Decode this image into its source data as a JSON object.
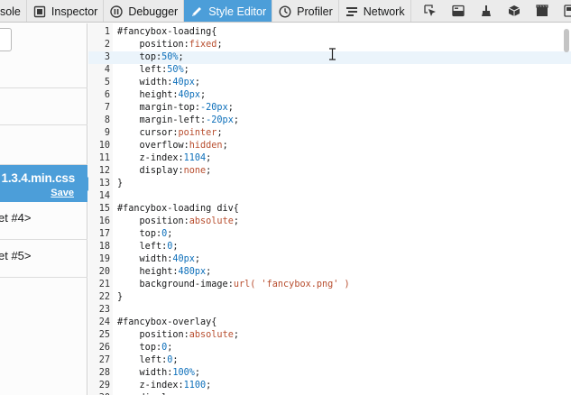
{
  "toolbar": {
    "tabs": [
      {
        "label": "Console",
        "shown": "nsole",
        "icon": "console-icon"
      },
      {
        "label": "Inspector",
        "icon": "inspector-icon"
      },
      {
        "label": "Debugger",
        "icon": "debugger-icon"
      },
      {
        "label": "Style Editor",
        "icon": "style-editor-icon",
        "active": true
      },
      {
        "label": "Profiler",
        "icon": "profiler-icon"
      },
      {
        "label": "Network",
        "icon": "network-icon"
      }
    ],
    "tool_buttons": [
      "pick-element-icon",
      "split-console-icon",
      "paint-flashing-icon",
      "3d-view-icon",
      "screenshot-icon",
      "more-icon"
    ]
  },
  "sidebar": {
    "active_sheet": {
      "name": "1.3.4.min.css",
      "save_label": "Save"
    },
    "other_sheets": [
      {
        "label": "et #4>"
      },
      {
        "label": "et #5>"
      }
    ]
  },
  "editor": {
    "lines": [
      {
        "n": "1",
        "t": "#fancybox-loading{"
      },
      {
        "n": "2",
        "p": "position",
        "v": "fixed"
      },
      {
        "n": "3",
        "p": "top",
        "v": "50%",
        "hl": true
      },
      {
        "n": "4",
        "p": "left",
        "v": "50%"
      },
      {
        "n": "5",
        "p": "width",
        "v": "40px"
      },
      {
        "n": "6",
        "p": "height",
        "v": "40px"
      },
      {
        "n": "7",
        "p": "margin-top",
        "v": "-20px"
      },
      {
        "n": "8",
        "p": "margin-left",
        "v": "-20px"
      },
      {
        "n": "9",
        "p": "cursor",
        "v": "pointer"
      },
      {
        "n": "10",
        "p": "overflow",
        "v": "hidden"
      },
      {
        "n": "11",
        "p": "z-index",
        "v": "1104"
      },
      {
        "n": "12",
        "p": "display",
        "v": "none"
      },
      {
        "n": "13",
        "t": "}"
      },
      {
        "n": "14",
        "t": ""
      },
      {
        "n": "15",
        "t": "#fancybox-loading div{"
      },
      {
        "n": "16",
        "p": "position",
        "v": "absolute"
      },
      {
        "n": "17",
        "p": "top",
        "v": "0"
      },
      {
        "n": "18",
        "p": "left",
        "v": "0"
      },
      {
        "n": "19",
        "p": "width",
        "v": "40px"
      },
      {
        "n": "20",
        "p": "height",
        "v": "480px"
      },
      {
        "n": "21",
        "p": "background-image",
        "v": "url( 'fancybox.png' )",
        "url": true
      },
      {
        "n": "22",
        "t": "}"
      },
      {
        "n": "23",
        "t": ""
      },
      {
        "n": "24",
        "t": "#fancybox-overlay{"
      },
      {
        "n": "25",
        "p": "position",
        "v": "absolute"
      },
      {
        "n": "26",
        "p": "top",
        "v": "0"
      },
      {
        "n": "27",
        "p": "left",
        "v": "0"
      },
      {
        "n": "28",
        "p": "width",
        "v": "100%"
      },
      {
        "n": "29",
        "p": "z-index",
        "v": "1100"
      },
      {
        "n": "30",
        "p": "displ",
        "v": "",
        "partial": true
      }
    ]
  },
  "colors": {
    "accent": "#4c9ed9",
    "keyword_value": "#b84e2f",
    "number": "#0d6fba",
    "line_highlight": "#ebf4fb"
  }
}
